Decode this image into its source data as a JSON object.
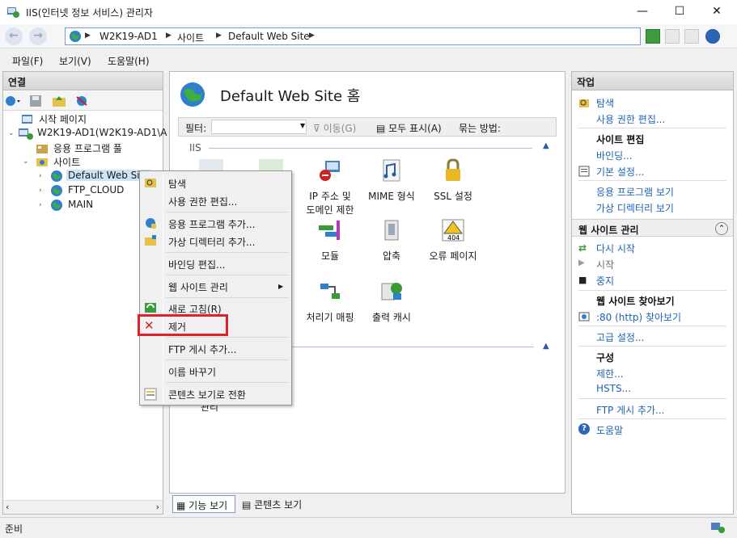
{
  "window": {
    "title": "IIS(인터넷 정보 서비스) 관리자",
    "controls": {
      "minimize": "—",
      "maximize": "☐",
      "close": "✕"
    }
  },
  "address": {
    "crumbs": [
      "W2K19-AD1",
      "사이트",
      "Default Web Site"
    ]
  },
  "menu": {
    "items": [
      "파일(F)",
      "보기(V)",
      "도움말(H)"
    ]
  },
  "connections": {
    "title": "연결",
    "tree": [
      {
        "label": "시작 페이지",
        "level": 1
      },
      {
        "label": "W2K19-AD1(W2K19-AD1\\A",
        "level": 1
      },
      {
        "label": "응용 프로그램 풀",
        "level": 2
      },
      {
        "label": "사이트",
        "level": 2
      },
      {
        "label": "Default Web Site",
        "level": 3
      },
      {
        "label": "FTP_CLOUD",
        "level": 3
      },
      {
        "label": "MAIN",
        "level": 3
      }
    ]
  },
  "center": {
    "title": "Default Web Site 홈",
    "filter": {
      "label": "필터:",
      "go": "이동(G)",
      "show_all": "모두 표시(A)",
      "group_by": "묶는 방법:"
    },
    "section": "IIS",
    "features": [
      {
        "label": "IP 주소 및\n도메인 제한"
      },
      {
        "label": "MIME 형식"
      },
      {
        "label": "SSL 설정"
      },
      {
        "label": "모듈"
      },
      {
        "label": "압축"
      },
      {
        "label": "오류 페이지"
      },
      {
        "label": "처리기 매핑"
      },
      {
        "label": "출력 캐시"
      }
    ],
    "partial_label": "관리",
    "view_tabs": [
      "기능 보기",
      "콘텐츠 보기"
    ]
  },
  "actions": {
    "title": "작업",
    "top": [
      "탐색",
      "사용 권한 편집..."
    ],
    "site_edit_head": "사이트 편집",
    "site_edit": [
      "바인딩...",
      "기본 설정...",
      "응용 프로그램 보기",
      "가상 디렉터리 보기"
    ],
    "manage_head": "웹 사이트 관리",
    "manage": [
      "다시 시작",
      "시작",
      "중지"
    ],
    "browse_head": "웹 사이트 찾아보기",
    "browse": [
      ":80 (http) 찾아보기",
      "고급 설정..."
    ],
    "config_head": "구성",
    "config": [
      "제한...",
      "HSTS...",
      "FTP 게시 추가..."
    ],
    "help": "도움말"
  },
  "context_menu": {
    "items": [
      "탐색",
      "사용 권한 편집...",
      "응용 프로그램 추가...",
      "가상 디렉터리 추가...",
      "바인딩 편집...",
      "웹 사이트 관리",
      "새로 고침(R)",
      "제거",
      "FTP 게시 추가...",
      "이름 바꾸기",
      "콘텐츠 보기로 전환"
    ],
    "highlighted": "제거"
  },
  "status": {
    "text": "준비"
  },
  "colors": {
    "accent_link": "#1e64b4",
    "highlight_border": "#e0202a"
  }
}
